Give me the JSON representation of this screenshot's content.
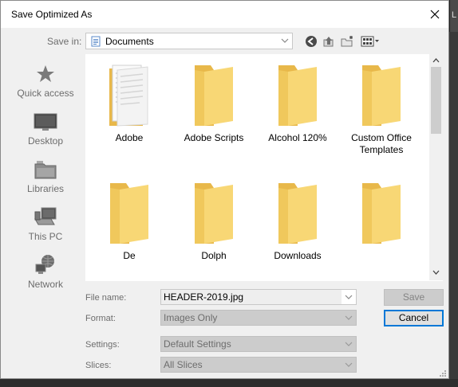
{
  "dialog": {
    "title": "Save Optimized As",
    "close_glyph": "✕"
  },
  "savein": {
    "label": "Save in:",
    "value": "Documents",
    "icon": "documents-folder-icon"
  },
  "toolbar": {
    "icons": [
      "back-icon",
      "up-folder-icon",
      "new-folder-icon",
      "view-menu-icon"
    ]
  },
  "places": [
    {
      "label": "Quick access",
      "icon": "star-icon"
    },
    {
      "label": "Desktop",
      "icon": "desktop-icon"
    },
    {
      "label": "Libraries",
      "icon": "libraries-icon"
    },
    {
      "label": "This PC",
      "icon": "computer-icon"
    },
    {
      "label": "Network",
      "icon": "network-icon"
    }
  ],
  "files": [
    {
      "name": "Adobe",
      "icon": "folder-with-documents-icon"
    },
    {
      "name": "Adobe Scripts",
      "icon": "folder-icon"
    },
    {
      "name": "Alcohol 120%",
      "icon": "folder-icon"
    },
    {
      "name": "Custom Office Templates",
      "icon": "folder-icon"
    },
    {
      "name": "De",
      "icon": "folder-icon"
    },
    {
      "name": "Dolph",
      "icon": "folder-icon"
    },
    {
      "name": "Downloads",
      "icon": "folder-icon"
    },
    {
      "name": "",
      "icon": "folder-icon"
    }
  ],
  "form": {
    "filename_label": "File name:",
    "filename_value": "HEADER-2019.jpg",
    "format_label": "Format:",
    "format_value": "Images Only",
    "settings_label": "Settings:",
    "settings_value": "Default Settings",
    "slices_label": "Slices:",
    "slices_value": "All Slices"
  },
  "buttons": {
    "save": "Save",
    "cancel": "Cancel"
  },
  "colors": {
    "folder": "#f8d775",
    "folder_dark": "#e8b84a",
    "redaction": "#e8141e",
    "focus": "#0078d7"
  }
}
